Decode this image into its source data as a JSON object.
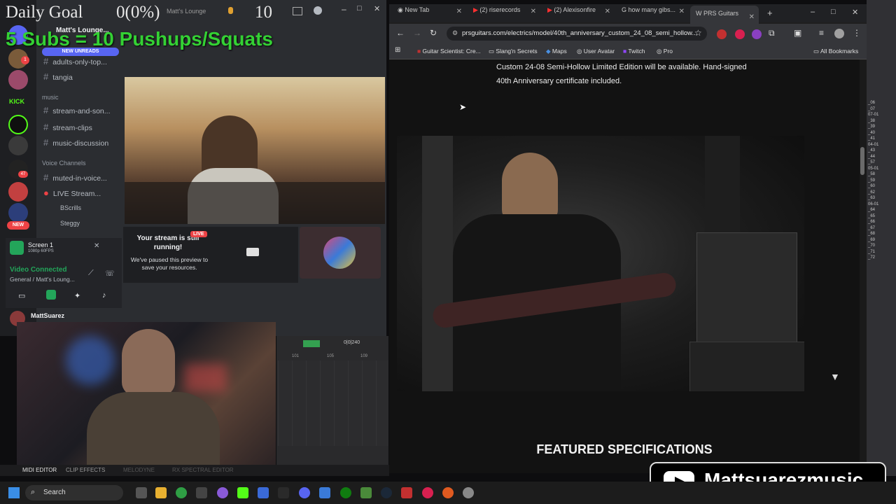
{
  "overlay": {
    "daily_goal_label": "Daily Goal",
    "goal_value": "0(0%)",
    "goal_count": "10",
    "subs_goal": "5 Subs = 10 Pushups/Squats",
    "discord_top_label": "Matt's Lounge"
  },
  "discord": {
    "server_name": "Matt's Lounge...",
    "new_unreads": "NEW UNREADS",
    "channels": [
      {
        "name": "adults-only-top..."
      },
      {
        "name": "tangia"
      }
    ],
    "music_category": "music",
    "music_channels": [
      {
        "name": "stream-and-son..."
      },
      {
        "name": "stream-clips"
      },
      {
        "name": "music-discussion"
      }
    ],
    "voice_category": "Voice Channels",
    "voice_channels": [
      {
        "name": "muted-in-voice..."
      },
      {
        "name": "LIVE Stream..."
      }
    ],
    "voice_users": [
      "BScrills",
      "Steggy"
    ],
    "stream_paused_title": "Your stream is still running!",
    "stream_paused_sub": "We've paused this preview to save your resources.",
    "live_badge": "LIVE",
    "screen_label": "Screen 1",
    "screen_quality": "1080p 60FPS",
    "video_connected": "Video Connected",
    "voice_location": "General / Matt's Loung...",
    "username": "MattSuarez",
    "new_badge": "NEW",
    "kick_label": "KICK",
    "ping_count": "1",
    "rail_count": "47"
  },
  "daw": {
    "timecode": "0|0|240",
    "bars": [
      "101",
      "105",
      "109"
    ],
    "tabs": [
      "MIDI EDITOR",
      "CLIP EFFECTS",
      "MELODYNE",
      "RX SPECTRAL EDITOR"
    ]
  },
  "chrome": {
    "tabs": [
      {
        "label": "New Tab"
      },
      {
        "label": "(2) riserecords"
      },
      {
        "label": "(2) Alexisonfire"
      },
      {
        "label": "how many gibs..."
      },
      {
        "label": "PRS Guitars"
      }
    ],
    "url": "prsguitars.com/electrics/model/40th_anniversary_custom_24_08_semi_hollow...",
    "bookmarks": [
      {
        "label": "Guitar Scientist: Cre..."
      },
      {
        "label": "Slang'n Secrets"
      },
      {
        "label": "Maps"
      },
      {
        "label": "User Avatar"
      },
      {
        "label": "Twitch"
      },
      {
        "label": "Pro"
      }
    ],
    "all_bookmarks": "All Bookmarks"
  },
  "page": {
    "desc_line1": "Custom 24-08 Semi-Hollow Limited Edition will be available. Hand-signed",
    "desc_line2": "40th Anniversary certificate included.",
    "featured": "FEATURED SPECIFICATIONS"
  },
  "youtube": {
    "channel": "Mattsuarezmusic"
  },
  "taskbar": {
    "search_placeholder": "Search"
  },
  "right_strip": {
    "lines": [
      "_06",
      "_07",
      "07-01",
      "_38",
      "_39",
      "_40",
      "_41",
      "04-01",
      "_43",
      "_44",
      "_57",
      "05-01",
      "_58",
      "_59",
      "_60",
      "_62",
      "_63",
      "06-01",
      "_64",
      "_65",
      "_66",
      "_67",
      "_68",
      "_69",
      "_70",
      "_71",
      "_72"
    ]
  },
  "colors": {
    "goal_green": "#34d134",
    "discord_bg": "#2b2d31",
    "chrome_bg": "#202124",
    "video_connected_green": "#23a55a",
    "live_red": "#ed4245"
  }
}
